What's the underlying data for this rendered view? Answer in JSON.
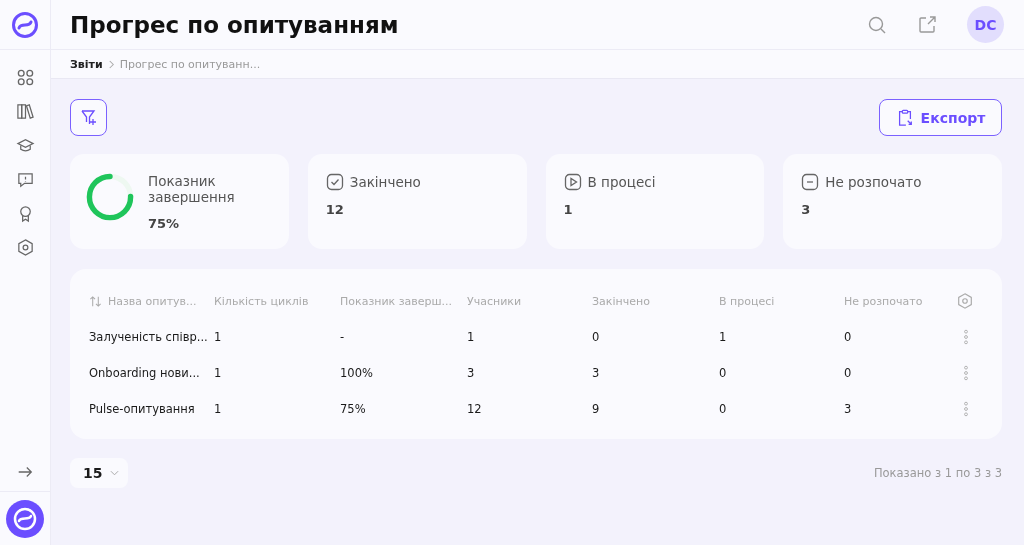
{
  "header": {
    "title": "Прогрес по опитуванням",
    "avatar": "DC"
  },
  "breadcrumb": [
    {
      "label": "Звіти",
      "current": false
    },
    {
      "label": "Прогрес по опитуванн...",
      "current": true
    }
  ],
  "export_button": "Експорт",
  "stats": [
    {
      "kind": "rate",
      "label": "Показник завершення",
      "value": "75%"
    },
    {
      "kind": "completed",
      "label": "Закінчено",
      "value": "12"
    },
    {
      "kind": "in_progress",
      "label": "В процесі",
      "value": "1"
    },
    {
      "kind": "not_started",
      "label": "Не розпочато",
      "value": "3"
    }
  ],
  "table": {
    "columns": [
      "Назва опитув...",
      "Кількість циклів",
      "Показник заверш...",
      "Учасники",
      "Закінчено",
      "В процесі",
      "Не розпочато"
    ],
    "rows": [
      [
        "Залученість співр...",
        "1",
        "-",
        "1",
        "0",
        "1",
        "0"
      ],
      [
        "Onboarding нови...",
        "1",
        "100%",
        "3",
        "3",
        "0",
        "0"
      ],
      [
        "Pulse-опитування",
        "1",
        "75%",
        "12",
        "9",
        "0",
        "3"
      ]
    ]
  },
  "pagination": {
    "page_size": "15",
    "summary": "Показано з 1 по 3 з 3"
  }
}
